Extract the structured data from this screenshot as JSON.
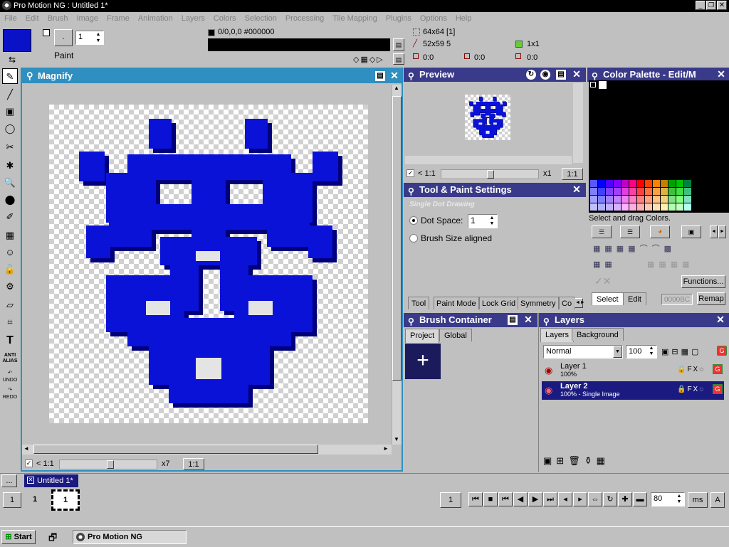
{
  "app": {
    "title": "Pro Motion NG : Untitled 1*"
  },
  "menu": [
    "File",
    "Edit",
    "Brush",
    "Image",
    "Frame",
    "Animation",
    "Layers",
    "Colors",
    "Selection",
    "Processing",
    "Tile Mapping",
    "Plugins",
    "Options",
    "Help"
  ],
  "toolbar": {
    "paint_label": "Paint",
    "brush_size": "1",
    "brush_dot": ".",
    "color_readout": "0/0,0,0 #000000",
    "canvas_size": "64x64 [1]",
    "selection_size": "52x59 5",
    "pos_a": "0:0",
    "pos_b": "0:0",
    "pos_c": "0:0",
    "grid": "1x1",
    "primary_color": "#0a12c8"
  },
  "magnify": {
    "title": "Magnify",
    "zoom_ratio": "< 1:1",
    "zoom_factor": "x7",
    "one_to_one": "1:1"
  },
  "preview": {
    "title": "Preview",
    "zoom_ratio": "< 1:1",
    "zoom_factor": "x1",
    "one_to_one": "1:1"
  },
  "palette": {
    "title": "Color Palette - Edit/M",
    "hint": "Select and drag Colors.",
    "functions_label": "Functions...",
    "select_tab": "Select",
    "edit_tab": "Edit",
    "hex_field": "0000BC",
    "remap_label": "Remap",
    "ramp_colors": [
      [
        "#5858ff",
        "#0000ff",
        "#5000ff",
        "#8000ff",
        "#c000c0",
        "#ff0080",
        "#ff0000",
        "#ff4000",
        "#ff8000",
        "#c08000",
        "#00a000",
        "#00c000",
        "#008040"
      ],
      [
        "#8080ff",
        "#4040ff",
        "#8040ff",
        "#a040ff",
        "#e040e0",
        "#ff40a0",
        "#ff4040",
        "#ff7040",
        "#ffa040",
        "#e0b040",
        "#40c040",
        "#40e040",
        "#40c080"
      ],
      [
        "#a0a0ff",
        "#8080ff",
        "#a080ff",
        "#c080ff",
        "#f080f0",
        "#ff80c0",
        "#ff8080",
        "#ffa080",
        "#ffc080",
        "#f0d080",
        "#80e080",
        "#80ff80",
        "#80e0c0"
      ],
      [
        "#c0c0ff",
        "#b0b0ff",
        "#c0b0ff",
        "#d8b0ff",
        "#ffb0ff",
        "#ffb0e0",
        "#ffb0b0",
        "#ffc8b0",
        "#ffe0b0",
        "#fff0b0",
        "#b0ffb0",
        "#c0ffc0",
        "#b0fff0"
      ]
    ]
  },
  "tool_settings": {
    "title": "Tool & Paint Settings",
    "mode_heading": "Single Dot Drawing",
    "dot_space_label": "Dot Space:",
    "dot_space_value": "1",
    "brush_aligned_label": "Brush Size aligned",
    "tabs": [
      "Tool",
      "Paint Mode",
      "Lock Grid",
      "Symmetry",
      "Co"
    ]
  },
  "brush_container": {
    "title": "Brush Container",
    "tabs": [
      "Project",
      "Global"
    ]
  },
  "layers": {
    "title": "Layers",
    "tabs": [
      "Layers",
      "Background"
    ],
    "blend_mode": "Normal",
    "opacity": "100",
    "items": [
      {
        "name": "Layer 1",
        "detail": "100%"
      },
      {
        "name": "Layer 2",
        "detail": "100% - Single Image"
      }
    ]
  },
  "doc_tabs": {
    "more": "...",
    "active": "Untitled 1*"
  },
  "timeline": {
    "frame_left": "1",
    "frame_current": "1",
    "frame_thumb": "1",
    "frame_right": "1",
    "delay": "80",
    "unit": "ms",
    "mode": "A"
  },
  "taskbar": {
    "start": "Start",
    "app": "Pro Motion NG"
  }
}
